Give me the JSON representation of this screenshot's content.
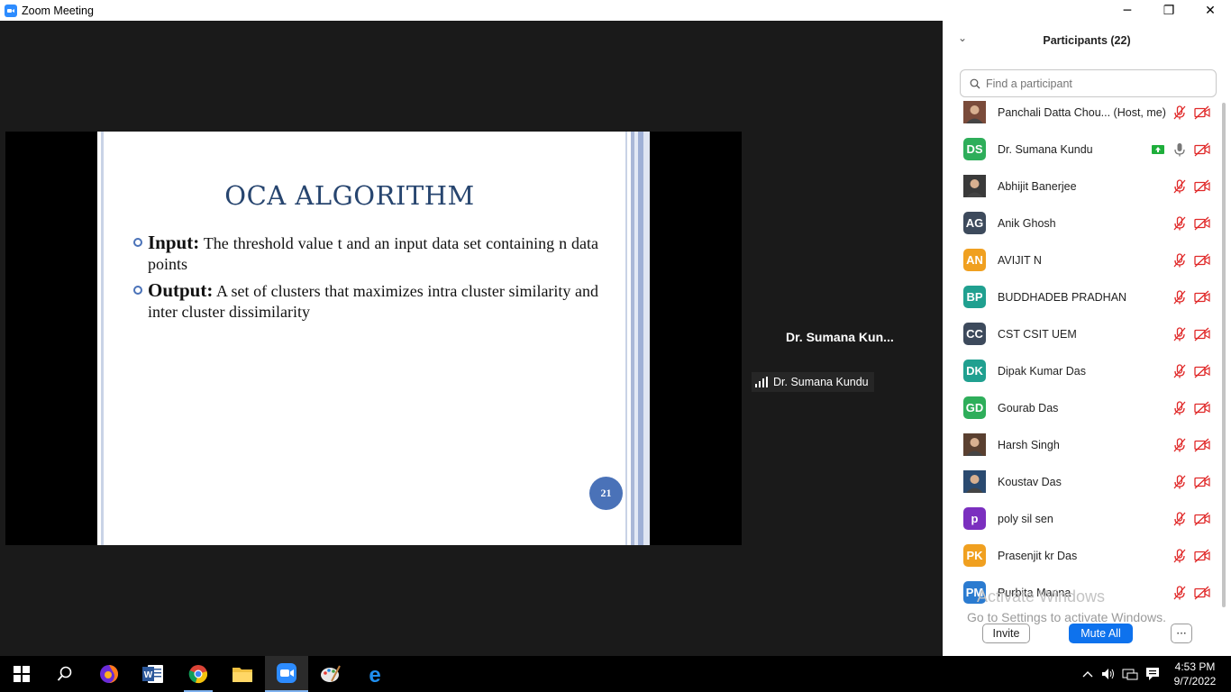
{
  "window": {
    "title": "Zoom Meeting",
    "minimize": "─",
    "restore": "❐",
    "close": "✕"
  },
  "slide": {
    "title": "OCA ALGORITHM",
    "bullets": [
      {
        "label": "Input:",
        "text": " The threshold value t and an input data set containing n data points"
      },
      {
        "label": "Output:",
        "text": " A set of clusters that maximizes intra cluster similarity and inter cluster dissimilarity"
      }
    ],
    "page_number": "21"
  },
  "speaker": {
    "name_truncated": "Dr. Sumana Kun...",
    "tag_name": "Dr. Sumana Kundu"
  },
  "participants_panel": {
    "title": "Participants (22)",
    "search_placeholder": "Find a participant",
    "participants": [
      {
        "name": "Panchali Datta Chou... (Host, me)",
        "initials": "",
        "avatar_color": "#7a4b3a",
        "photo": true,
        "mic": "muted",
        "video": "off",
        "sharing": false
      },
      {
        "name": "Dr. Sumana Kundu",
        "initials": "DS",
        "avatar_color": "#2eae5a",
        "photo": false,
        "mic": "on",
        "video": "off",
        "sharing": true
      },
      {
        "name": "Abhijit Banerjee",
        "initials": "",
        "avatar_color": "#3a3a3a",
        "photo": true,
        "mic": "muted",
        "video": "off",
        "sharing": false
      },
      {
        "name": "Anik Ghosh",
        "initials": "AG",
        "avatar_color": "#3d4a5c",
        "photo": false,
        "mic": "muted",
        "video": "off",
        "sharing": false
      },
      {
        "name": "AVIJIT N",
        "initials": "AN",
        "avatar_color": "#f0a020",
        "photo": false,
        "mic": "muted",
        "video": "off",
        "sharing": false
      },
      {
        "name": "BUDDHADEB PRADHAN",
        "initials": "BP",
        "avatar_color": "#20a090",
        "photo": false,
        "mic": "muted",
        "video": "off",
        "sharing": false
      },
      {
        "name": "CST CSIT UEM",
        "initials": "CC",
        "avatar_color": "#3d4a5c",
        "photo": false,
        "mic": "muted",
        "video": "off",
        "sharing": false
      },
      {
        "name": "Dipak Kumar Das",
        "initials": "DK",
        "avatar_color": "#20a090",
        "photo": false,
        "mic": "muted",
        "video": "off",
        "sharing": false
      },
      {
        "name": "Gourab Das",
        "initials": "GD",
        "avatar_color": "#2eae5a",
        "photo": false,
        "mic": "muted",
        "video": "off",
        "sharing": false
      },
      {
        "name": "Harsh Singh",
        "initials": "",
        "avatar_color": "#5a4030",
        "photo": true,
        "mic": "muted",
        "video": "off",
        "sharing": false
      },
      {
        "name": "Koustav Das",
        "initials": "",
        "avatar_color": "#2a4a70",
        "photo": true,
        "mic": "muted",
        "video": "off",
        "sharing": false
      },
      {
        "name": "poly sil sen",
        "initials": "p",
        "avatar_color": "#7b2fbf",
        "photo": false,
        "mic": "muted",
        "video": "off",
        "sharing": false
      },
      {
        "name": "Prasenjit  kr Das",
        "initials": "PK",
        "avatar_color": "#f0a020",
        "photo": false,
        "mic": "muted",
        "video": "off",
        "sharing": false
      },
      {
        "name": "Purbita Manna",
        "initials": "PM",
        "avatar_color": "#2b7bd0",
        "photo": false,
        "mic": "muted",
        "video": "off",
        "sharing": false
      }
    ],
    "watermark_line1": "Activate Windows",
    "watermark_line2": "Go to Settings to activate Windows.",
    "invite_label": "Invite",
    "mute_all_label": "Mute All",
    "more_label": "···"
  },
  "taskbar": {
    "apps": [
      "windows-start",
      "search",
      "firefox",
      "word",
      "chrome",
      "file-explorer",
      "zoom",
      "paint",
      "edge"
    ],
    "time": "4:53 PM",
    "date": "9/7/2022"
  },
  "colors": {
    "zoom_blue": "#0e72ed",
    "slide_accent": "#4a72b8",
    "muted_red": "#e02828"
  }
}
